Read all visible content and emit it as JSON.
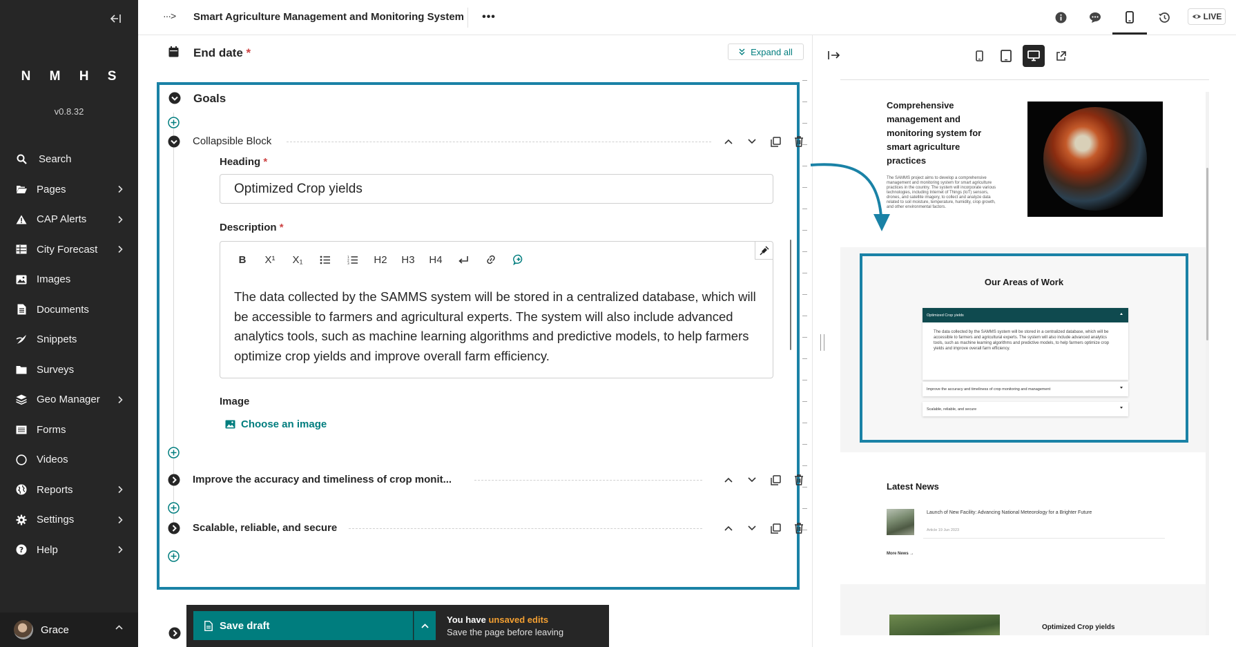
{
  "sidebar": {
    "brand": "N M H S",
    "version": "v0.8.32",
    "items": [
      {
        "label": "Search",
        "icon": "search-icon"
      },
      {
        "label": "Pages",
        "icon": "folder-open-icon",
        "expandable": true
      },
      {
        "label": "CAP Alerts",
        "icon": "warning-icon",
        "expandable": true
      },
      {
        "label": "City Forecast",
        "icon": "table-icon",
        "expandable": true
      },
      {
        "label": "Images",
        "icon": "image-icon"
      },
      {
        "label": "Documents",
        "icon": "document-icon"
      },
      {
        "label": "Snippets",
        "icon": "snippet-icon"
      },
      {
        "label": "Surveys",
        "icon": "folder-icon"
      },
      {
        "label": "Geo Manager",
        "icon": "layers-icon",
        "expandable": true
      },
      {
        "label": "Forms",
        "icon": "list-icon"
      },
      {
        "label": "Videos",
        "icon": "circle-icon"
      },
      {
        "label": "Reports",
        "icon": "globe-icon",
        "expandable": true
      },
      {
        "label": "Settings",
        "icon": "cog-icon",
        "expandable": true
      },
      {
        "label": "Help",
        "icon": "help-icon",
        "expandable": true
      }
    ],
    "user": {
      "name": "Grace"
    }
  },
  "header": {
    "title": "Smart Agriculture Management and Monitoring System",
    "live_label": "LIVE"
  },
  "editor": {
    "end_date_label": "End date",
    "required_mark": "*",
    "expand_all_label": "Expand all",
    "goals_label": "Goals",
    "collapsible_block_label": "Collapsible Block",
    "heading_label": "Heading",
    "heading_value": "Optimized Crop yields",
    "description_label": "Description",
    "toolbar": [
      "B",
      "X¹",
      "X₁",
      "•≡",
      "1≡",
      "H2",
      "H3",
      "H4",
      "↵",
      "link",
      "comment"
    ],
    "description_text": "The data collected by the SAMMS system will be stored in a centralized database, which will be accessible to farmers and agricultural experts. The system will also include advanced analytics tools, such as machine learning algorithms and predictive models, to help farmers optimize crop yields and improve overall farm efficiency.",
    "image_label": "Image",
    "choose_image_label": "Choose an image",
    "block2_label": "Improve the accuracy and timeliness of crop monit...",
    "block3_label": "Scalable, reliable, and secure"
  },
  "savebar": {
    "save_label": "Save draft",
    "msg_prefix": "You have ",
    "msg_warn": "unsaved edits",
    "msg_line2": "Save the page before leaving"
  },
  "preview": {
    "hero_title": "Comprehensive management and monitoring system for smart agriculture practices",
    "hero_text": "The SAMMS project aims to develop a comprehensive management and monitoring system for smart agriculture practices in the country. The system will incorporate various technologies, including Internet of Things (IoT) sensors, drones, and satellite imagery, to collect and analyze data related to soil moisture, temperature, humidity, crop growth, and other environmental factors.",
    "areas_title": "Our Areas of Work",
    "accordion": [
      {
        "title": "Optimized Crop yields",
        "open": true,
        "body": "The data collected by the SAMMS system will be stored in a centralized database, which will be accessible to farmers and agricultural experts. The system will also include advanced analytics tools, such as machine learning algorithms and predictive models, to help farmers optimize crop yields and improve overall farm efficiency."
      },
      {
        "title": "Improve the accuracy and timeliness of crop monitoring and management",
        "open": false
      },
      {
        "title": "Scalable, reliable, and secure",
        "open": false
      }
    ],
    "news_title": "Latest News",
    "news_item": "Launch of New Facility: Advancing National Meteorology for a Brighter Future",
    "news_meta": "Article     19 Jun 2023",
    "more_news": "More News →",
    "bottom_title": "Optimized Crop yields"
  },
  "colors": {
    "sidebar": "#262626",
    "accent": "#007d7e",
    "highlight": "#1a82a6",
    "required": "#cd4444",
    "warning": "#f4a032"
  }
}
